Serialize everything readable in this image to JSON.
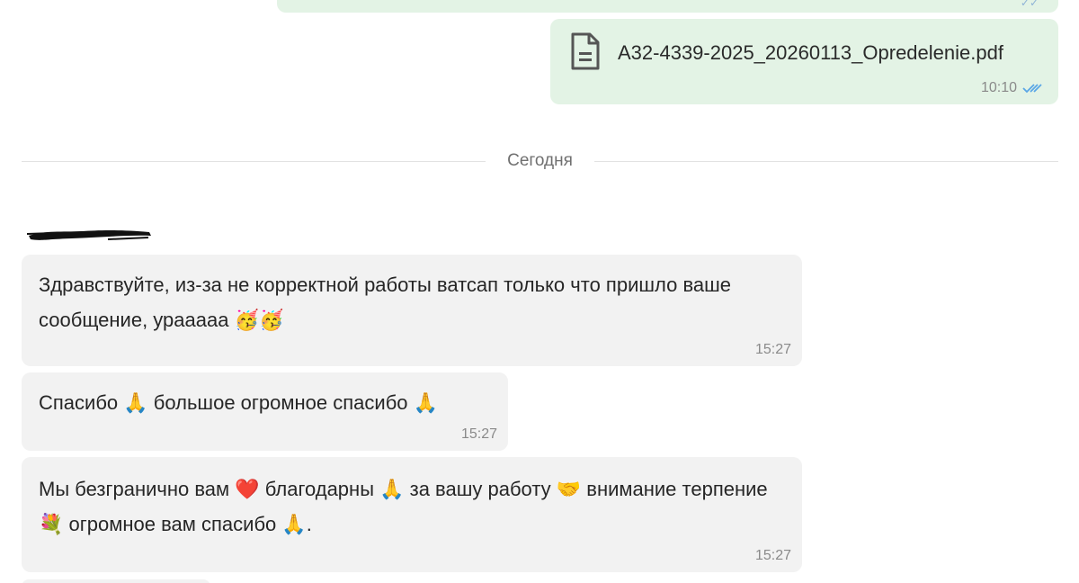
{
  "top_bubble": {
    "status_icon": "double-check-icon"
  },
  "file_message": {
    "icon": "document-icon",
    "file_name": "A32-4339-2025_20260113_Opredelenie.pdf",
    "time": "10:10",
    "status_icon": "double-check-read-icon"
  },
  "date_divider": "Сегодня",
  "incoming": [
    {
      "text": "Здравствуйте, из-за не корректной работы ватсап только что пришло ваше сообщение, урааааа 🥳🥳",
      "time": "15:27"
    },
    {
      "text": "Спасибо 🙏 большое огромное спасибо 🙏",
      "time": "15:27"
    },
    {
      "text": "Мы безгранично вам ❤️ благодарны 🙏 за вашу работу 🤝 внимание терпение 💐 огромное вам спасибо 🙏.",
      "time": "15:27"
    }
  ],
  "colors": {
    "outgoing_bubble": "#e3f3e5",
    "incoming_bubble": "#f2f2f2",
    "read_ticks": "#5aa6e6"
  }
}
